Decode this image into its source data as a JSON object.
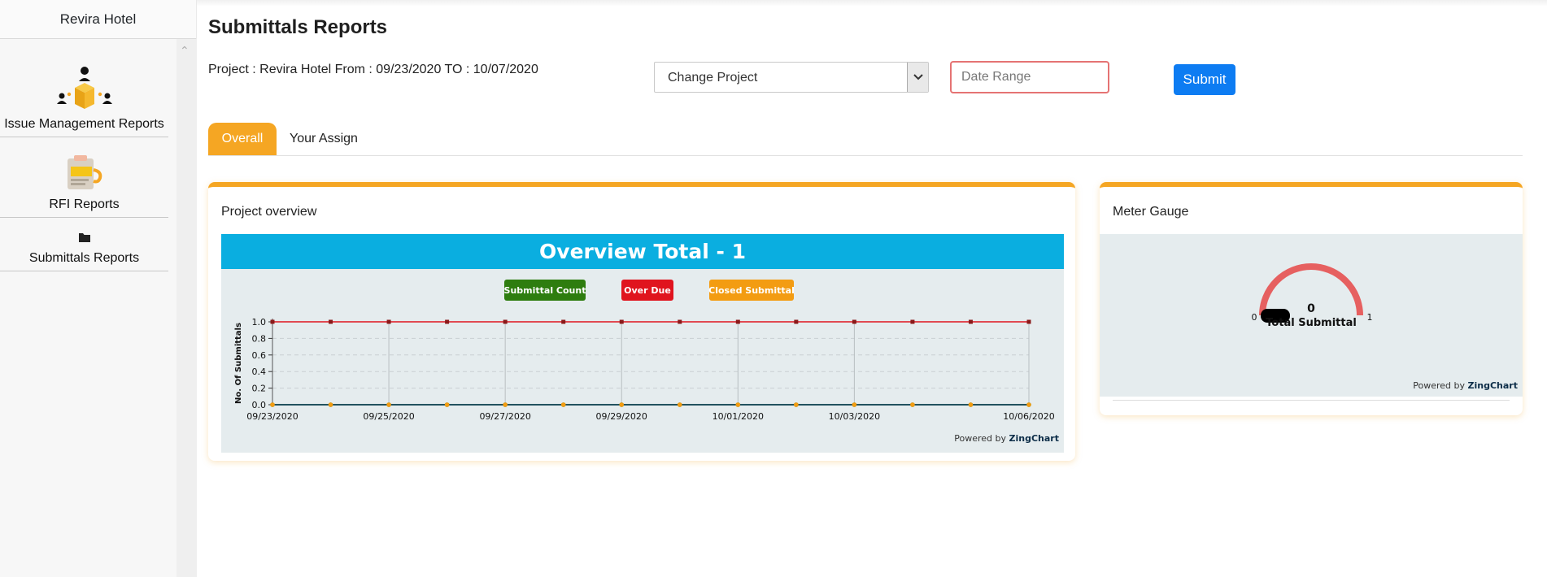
{
  "sidebar": {
    "title": "Revira Hotel",
    "items": [
      {
        "label": "Issue Management Reports",
        "icon": "team-box-icon"
      },
      {
        "label": "RFI Reports",
        "icon": "clipboard-icon"
      },
      {
        "label": "Submittals Reports",
        "icon": "folder-icon"
      }
    ]
  },
  "header": {
    "title": "Submittals Reports",
    "project_info": "Project : Revira Hotel From : 09/23/2020 TO : 10/07/2020",
    "project_select": "Change Project",
    "date_placeholder": "Date Range",
    "submit_label": "Submit"
  },
  "tabs": [
    {
      "label": "Overall",
      "active": true
    },
    {
      "label": "Your Assign",
      "active": false
    }
  ],
  "cards": {
    "overview_title": "Project overview",
    "gauge_title": "Meter Gauge"
  },
  "powered_by": {
    "prefix": "Powered by",
    "brand": "ZingChart"
  },
  "chart_data": [
    {
      "type": "line",
      "title": "Overview Total - 1",
      "ylabel": "No. Of Submittals",
      "xlabel": "",
      "ylim": [
        0,
        1
      ],
      "y_ticks": [
        "0.0",
        "0.2",
        "0.4",
        "0.6",
        "0.8",
        "1.0"
      ],
      "x": [
        "09/23/2020",
        "09/24/2020",
        "09/25/2020",
        "09/26/2020",
        "09/27/2020",
        "09/28/2020",
        "09/29/2020",
        "09/30/2020",
        "10/01/2020",
        "10/02/2020",
        "10/03/2020",
        "10/04/2020",
        "10/05/2020",
        "10/06/2020"
      ],
      "x_tick_labels": [
        "09/23/2020",
        "09/25/2020",
        "09/27/2020",
        "09/29/2020",
        "10/01/2020",
        "10/03/2020",
        "10/06/2020"
      ],
      "series": [
        {
          "name": "Submittal Count",
          "color": "#2e7d0f",
          "values": [
            0,
            0,
            0,
            0,
            0,
            0,
            0,
            0,
            0,
            0,
            0,
            0,
            0,
            0
          ]
        },
        {
          "name": "Over Due",
          "color": "#e0141e",
          "values": [
            1,
            1,
            1,
            1,
            1,
            1,
            1,
            1,
            1,
            1,
            1,
            1,
            1,
            1
          ]
        },
        {
          "name": "Closed Submittal",
          "color": "#f39c12",
          "values": [
            0,
            0,
            0,
            0,
            0,
            0,
            0,
            0,
            0,
            0,
            0,
            0,
            0,
            0
          ]
        }
      ],
      "legend": "top-center",
      "grid": true,
      "header_color": "#0aaee0"
    },
    {
      "type": "gauge",
      "min": 0,
      "max": 1,
      "value": 0,
      "value_label": "0",
      "label": "Total Submittal",
      "min_label": "0",
      "max_label": "1",
      "arc_color": "#e66060"
    }
  ]
}
